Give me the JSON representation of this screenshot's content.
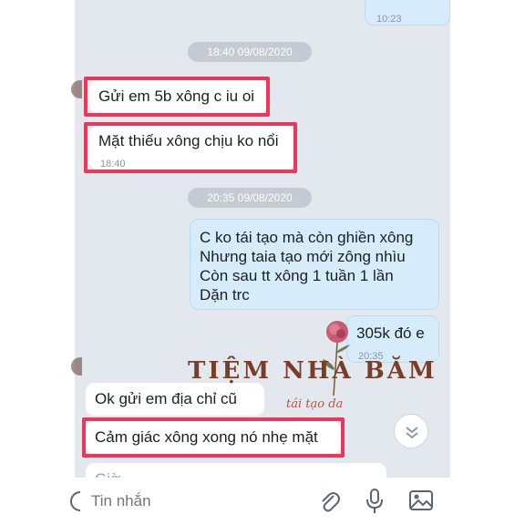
{
  "top_message": {
    "time": "10:23"
  },
  "date_dividers": [
    "18:40 09/08/2020",
    "20:35 09/08/2020"
  ],
  "messages": [
    {
      "text": "Gửi em 5b xông c iu oi",
      "direction": "in"
    },
    {
      "text": "Mặt thiếu xông chịu ko nổi",
      "direction": "in",
      "time": "18:40"
    },
    {
      "lines": [
        "C ko tái tạo mà còn ghiền xông",
        "Nhưng taia tạo mới zông nhìu",
        "Còn sau tt xông 1 tuần 1 lần",
        "Dặn trc"
      ],
      "direction": "out"
    },
    {
      "text": "305k đó e",
      "direction": "out",
      "time": "20:35"
    },
    {
      "text": "Ok gửi em địa chỉ cũ",
      "direction": "in"
    },
    {
      "text": "Cảm giác xông xong nó nhẹ mặt",
      "direction": "in"
    },
    {
      "text": "Giờ...",
      "direction": "in"
    }
  ],
  "watermark": {
    "title": "TIỆM NHÀ BĂM",
    "subtitle": "tái tạo da"
  },
  "input_bar": {
    "placeholder": "Tin nhắn",
    "icons": [
      "emoji-icon",
      "attachment-icon",
      "microphone-icon",
      "image-icon"
    ]
  },
  "colors": {
    "highlight": "#e8395d",
    "outgoing": "#d7ecfb",
    "incoming": "#ffffff",
    "background": "#e3e8ef"
  }
}
